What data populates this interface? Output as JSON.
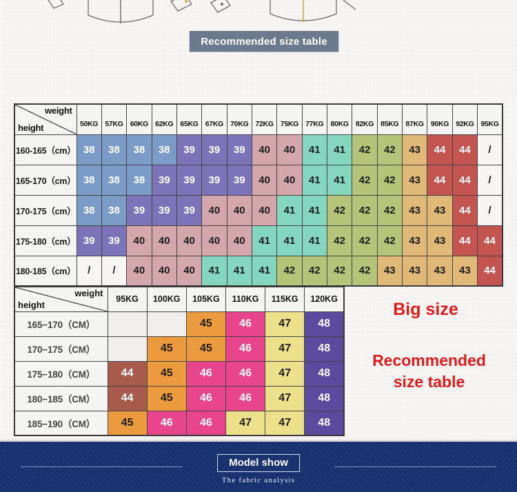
{
  "banner": {
    "title": "Recommended size table"
  },
  "table1": {
    "corner": {
      "weight_label": "weight",
      "height_label": "height"
    },
    "weights": [
      "50KG",
      "57KG",
      "60KG",
      "62KG",
      "65KG",
      "67KG",
      "70KG",
      "72KG",
      "75KG",
      "77KG",
      "80KG",
      "82KG",
      "85KG",
      "87KG",
      "90KG",
      "92KG",
      "95KG"
    ],
    "rows": [
      {
        "height": "160-165（cm）",
        "values": [
          "38",
          "38",
          "38",
          "38",
          "39",
          "39",
          "39",
          "40",
          "40",
          "41",
          "41",
          "42",
          "42",
          "43",
          "44",
          "44",
          "/"
        ]
      },
      {
        "height": "165-170（cm）",
        "values": [
          "38",
          "38",
          "38",
          "39",
          "39",
          "39",
          "39",
          "40",
          "40",
          "41",
          "41",
          "42",
          "42",
          "43",
          "44",
          "44",
          "/"
        ]
      },
      {
        "height": "170-175（cm）",
        "values": [
          "38",
          "38",
          "39",
          "39",
          "39",
          "40",
          "40",
          "40",
          "41",
          "41",
          "42",
          "42",
          "42",
          "43",
          "43",
          "44",
          "/"
        ]
      },
      {
        "height": "175-180（cm）",
        "values": [
          "39",
          "39",
          "40",
          "40",
          "40",
          "40",
          "40",
          "41",
          "41",
          "41",
          "42",
          "42",
          "42",
          "43",
          "43",
          "44",
          "44"
        ]
      },
      {
        "height": "180-185（cm）",
        "values": [
          "/",
          "/",
          "40",
          "40",
          "40",
          "41",
          "41",
          "41",
          "42",
          "42",
          "42",
          "42",
          "43",
          "43",
          "43",
          "43",
          "44"
        ]
      }
    ]
  },
  "table2": {
    "corner": {
      "weight_label": "weight",
      "height_label": "height"
    },
    "weights": [
      "95KG",
      "100KG",
      "105KG",
      "110KG",
      "115KG",
      "120KG"
    ],
    "rows": [
      {
        "height": "165−170（CM）",
        "values": [
          "",
          "",
          "45",
          "46",
          "47",
          "48"
        ]
      },
      {
        "height": "170−175（CM）",
        "values": [
          "",
          "45",
          "45",
          "46",
          "47",
          "48"
        ]
      },
      {
        "height": "175−180（CM）",
        "values": [
          "44",
          "45",
          "46",
          "46",
          "47",
          "48"
        ]
      },
      {
        "height": "180−185（CM）",
        "values": [
          "44",
          "45",
          "46",
          "46",
          "47",
          "48"
        ]
      },
      {
        "height": "185−190（CM）",
        "values": [
          "45",
          "46",
          "46",
          "47",
          "47",
          "48"
        ]
      }
    ]
  },
  "labels": {
    "big_size": "Big size",
    "recommended_line1": "Recommended",
    "recommended_line2": "size    table"
  },
  "footer": {
    "model_show": "Model show",
    "fabric_analysis": "The fabric analysis"
  },
  "palette": {
    "blue": "#7b9cc6",
    "purple": "#7d73b9",
    "pink_dusty": "#d4a7ac",
    "mint": "#84d6be",
    "olive": "#b5c478",
    "tan": "#e0b878",
    "red": "#c45450",
    "orange": "#eb9a3d",
    "magenta": "#e8458d",
    "yellow": "#ede08b",
    "violet": "#5b4b9e",
    "brown": "#a85b4c",
    "banner_bg": "#6b7a8d",
    "footer_bg": "#17306e",
    "accent_red": "#e01b1b"
  }
}
